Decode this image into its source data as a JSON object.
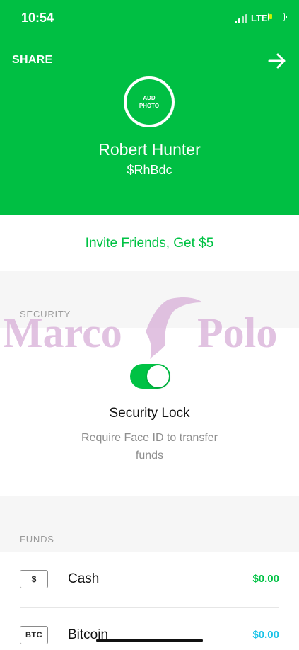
{
  "status": {
    "time": "10:54",
    "network": "LTE"
  },
  "header": {
    "share_label": "SHARE",
    "add_photo_line1": "ADD",
    "add_photo_line2": "PHOTO",
    "name": "Robert Hunter",
    "cashtag": "$RhBdc",
    "color": "#00bf43"
  },
  "invite": {
    "label": "Invite Friends, Get $5"
  },
  "security": {
    "section_label": "SECURITY",
    "toggle_on": true,
    "title": "Security Lock",
    "description": "Require Face ID to transfer funds"
  },
  "watermark": {
    "text": "Marco Polo"
  },
  "funds": {
    "section_label": "FUNDS",
    "items": [
      {
        "icon": "$",
        "name": "Cash",
        "amount": "$0.00",
        "amount_color": "#00c244"
      },
      {
        "icon": "BTC",
        "name": "Bitcoin",
        "amount": "$0.00",
        "amount_color": "#19c3e8"
      }
    ]
  }
}
